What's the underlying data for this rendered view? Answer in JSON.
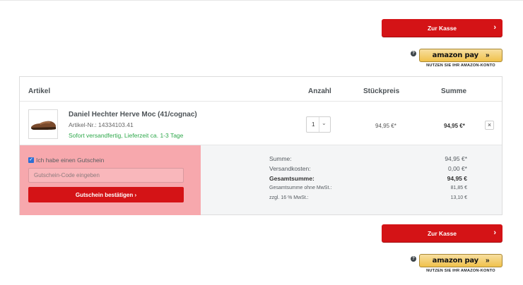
{
  "checkout": {
    "label": "Zur Kasse",
    "chevron": "›"
  },
  "amazon": {
    "help": "?",
    "brand": "amazon pay",
    "arrows": "»",
    "caption": "NUTZEN SIE IHR AMAZON-KONTO"
  },
  "table": {
    "headers": {
      "article": "Artikel",
      "quantity": "Anzahl",
      "unit_price": "Stückpreis",
      "total": "Summe"
    }
  },
  "item": {
    "name": "Daniel Hechter Herve Moc (41/cognac)",
    "article_no": "Artikel-Nr.: 14334103.41",
    "shipping": "Sofort versandfertig, Lieferzeit ca. 1-3 Tage",
    "quantity": "1",
    "unit_price": "94,95 €*",
    "total": "94,95 €*",
    "remove": "×",
    "thumbnail_icon": "shoe-image"
  },
  "voucher": {
    "checkbox_label": "Ich habe einen Gutschein",
    "checked": true,
    "input_placeholder": "Gutschein-Code eingeben",
    "button_label": "Gutschein bestätigen ›"
  },
  "summary": {
    "rows": [
      {
        "label": "Summe:",
        "value": "94,95 €*"
      },
      {
        "label": "Versandkosten:",
        "value": "0,00 €*"
      },
      {
        "label": "Gesamtsumme:",
        "value": "94,95 €"
      },
      {
        "label": "Gesamtsumme ohne MwSt.:",
        "value": "81,85 €"
      },
      {
        "label": "zzgl. 16 % MwSt.:",
        "value": "13,10 €"
      }
    ]
  },
  "colors": {
    "primary_red": "#d41316",
    "success_green": "#2ea84b",
    "highlight_pink": "#f7a8ad",
    "amazon_yellow": "#f0c14b"
  }
}
